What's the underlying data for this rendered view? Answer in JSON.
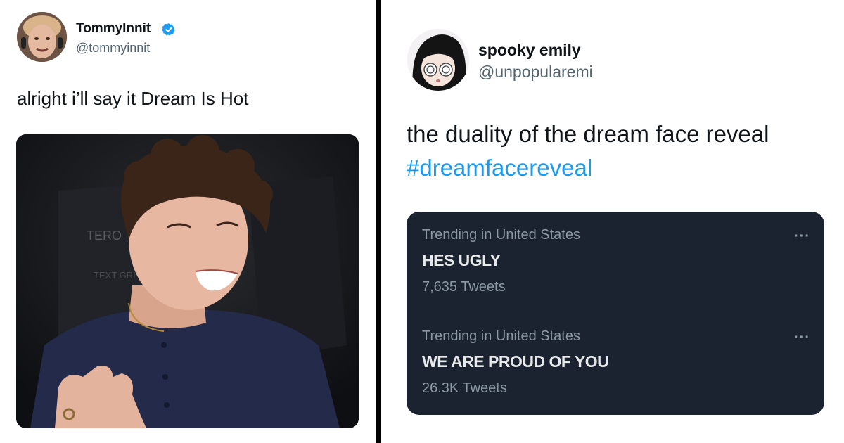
{
  "left_tweet": {
    "display_name": "TommyInnit",
    "handle": "@tommyinnit",
    "verified_icon": "verified-badge-icon",
    "text": "alright i’ll say it Dream Is Hot",
    "photo_overlay_text": {
      "chair_logo_1": "TERO",
      "chair_logo_2": "TEXT GRI"
    }
  },
  "right_tweet": {
    "display_name": "spooky emily",
    "handle": "@unpopularemi",
    "text": "the duality of the dream face reveal",
    "hashtag": "#dreamfacereveal",
    "trends": [
      {
        "context": "Trending in United States",
        "title": "HES UGLY",
        "count": "7,635 Tweets",
        "more": "···"
      },
      {
        "context": "Trending in United States",
        "title": "WE ARE PROUD OF YOU",
        "count": "26.3K Tweets",
        "more": "···"
      }
    ]
  },
  "colors": {
    "link": "#1d9bf0",
    "verified": "#1d9bf0",
    "trend_card_bg": "#1b2330",
    "secondary_text": "#536471"
  }
}
